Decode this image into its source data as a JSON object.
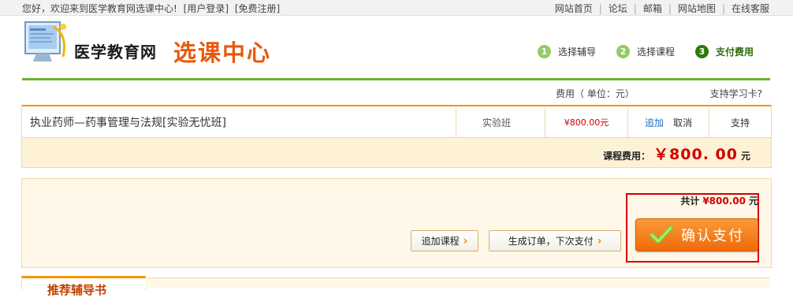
{
  "topbar": {
    "greeting": "您好，欢迎来到医学教育网选课中心!",
    "login": "[用户登录]",
    "register": "[免费注册]",
    "links": [
      "网站首页",
      "论坛",
      "邮箱",
      "网站地图",
      "在线客服"
    ]
  },
  "logo": {
    "title": "医学教育网",
    "subtitle": "选课中心"
  },
  "steps": [
    {
      "num": "1",
      "label": "选择辅导"
    },
    {
      "num": "2",
      "label": "选择课程"
    },
    {
      "num": "3",
      "label": "支付费用"
    }
  ],
  "fee_header": {
    "fee_unit": "费用（ 单位：元）",
    "study_card": "支持学习卡?"
  },
  "course": {
    "name": "执业药师—药事管理与法规[实验无忧班]",
    "class_type": "实验班",
    "price": "¥800.00元",
    "add": "追加",
    "cancel": "取消",
    "support": "支持",
    "fee_label": "课程费用：",
    "fee_amount": "￥800. 00",
    "fee_unit": "元"
  },
  "payment": {
    "total_label": "共计",
    "total_amount": "¥800.00",
    "total_unit": "元",
    "add_course": "追加课程",
    "create_order": "生成订单，下次支付",
    "confirm_pay": "确认支付"
  },
  "bottom_tab": "推荐辅导书",
  "colors": {
    "accent_orange": "#f29400",
    "price_red": "#d10000",
    "green": "#6cb32c",
    "highlight_frame": "#d40000"
  }
}
